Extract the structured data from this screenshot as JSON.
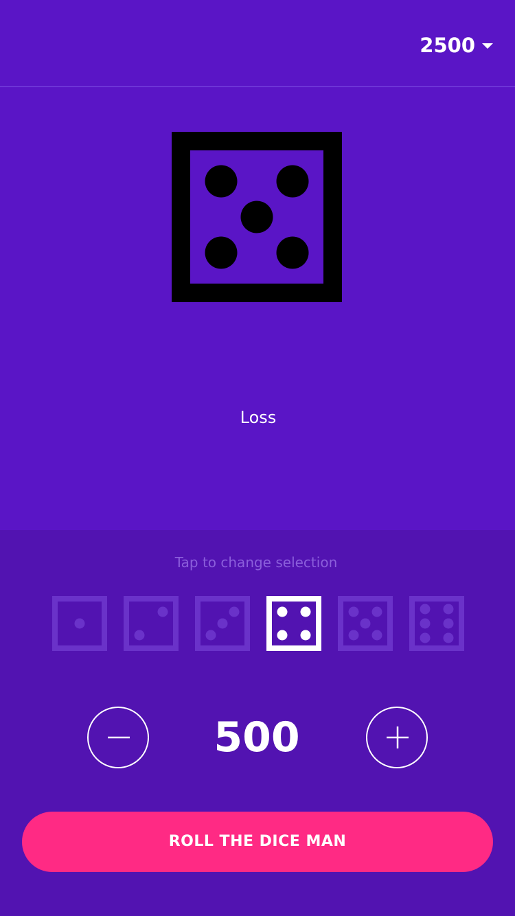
{
  "header": {
    "balance": "2500",
    "balance_dropdown_icon": "chevron-down-icon"
  },
  "result": {
    "die_face": 5,
    "die_icon": "die-five-icon",
    "label": "Loss"
  },
  "selection": {
    "hint": "Tap to change selection",
    "options": [
      {
        "face": 1,
        "icon": "die-one-icon",
        "selected": false
      },
      {
        "face": 2,
        "icon": "die-two-icon",
        "selected": false
      },
      {
        "face": 3,
        "icon": "die-three-icon",
        "selected": false
      },
      {
        "face": 4,
        "icon": "die-four-icon",
        "selected": true
      },
      {
        "face": 5,
        "icon": "die-five-icon",
        "selected": false
      },
      {
        "face": 6,
        "icon": "die-six-icon",
        "selected": false
      }
    ]
  },
  "bet": {
    "amount": "500",
    "decrease_icon": "minus-icon",
    "increase_icon": "plus-icon"
  },
  "actions": {
    "roll_label": "ROLL THE DICE MAN"
  },
  "colors": {
    "background": "#5a15c6",
    "panel": "#5213b1",
    "accent": "#ff2a84",
    "die_unselected": "#6a32c9",
    "die_selected": "#ffffff",
    "result_die": "#000000"
  }
}
